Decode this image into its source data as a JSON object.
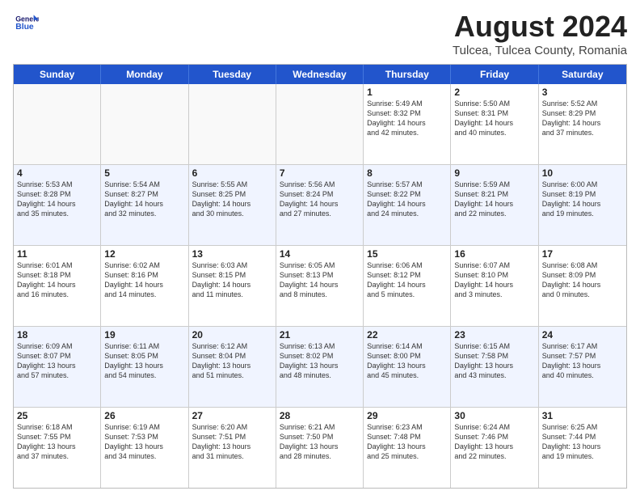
{
  "header": {
    "logo_line1": "General",
    "logo_line2": "Blue",
    "month": "August 2024",
    "location": "Tulcea, Tulcea County, Romania"
  },
  "weekdays": [
    "Sunday",
    "Monday",
    "Tuesday",
    "Wednesday",
    "Thursday",
    "Friday",
    "Saturday"
  ],
  "rows": [
    [
      {
        "day": "",
        "info": ""
      },
      {
        "day": "",
        "info": ""
      },
      {
        "day": "",
        "info": ""
      },
      {
        "day": "",
        "info": ""
      },
      {
        "day": "1",
        "info": "Sunrise: 5:49 AM\nSunset: 8:32 PM\nDaylight: 14 hours\nand 42 minutes."
      },
      {
        "day": "2",
        "info": "Sunrise: 5:50 AM\nSunset: 8:31 PM\nDaylight: 14 hours\nand 40 minutes."
      },
      {
        "day": "3",
        "info": "Sunrise: 5:52 AM\nSunset: 8:29 PM\nDaylight: 14 hours\nand 37 minutes."
      }
    ],
    [
      {
        "day": "4",
        "info": "Sunrise: 5:53 AM\nSunset: 8:28 PM\nDaylight: 14 hours\nand 35 minutes."
      },
      {
        "day": "5",
        "info": "Sunrise: 5:54 AM\nSunset: 8:27 PM\nDaylight: 14 hours\nand 32 minutes."
      },
      {
        "day": "6",
        "info": "Sunrise: 5:55 AM\nSunset: 8:25 PM\nDaylight: 14 hours\nand 30 minutes."
      },
      {
        "day": "7",
        "info": "Sunrise: 5:56 AM\nSunset: 8:24 PM\nDaylight: 14 hours\nand 27 minutes."
      },
      {
        "day": "8",
        "info": "Sunrise: 5:57 AM\nSunset: 8:22 PM\nDaylight: 14 hours\nand 24 minutes."
      },
      {
        "day": "9",
        "info": "Sunrise: 5:59 AM\nSunset: 8:21 PM\nDaylight: 14 hours\nand 22 minutes."
      },
      {
        "day": "10",
        "info": "Sunrise: 6:00 AM\nSunset: 8:19 PM\nDaylight: 14 hours\nand 19 minutes."
      }
    ],
    [
      {
        "day": "11",
        "info": "Sunrise: 6:01 AM\nSunset: 8:18 PM\nDaylight: 14 hours\nand 16 minutes."
      },
      {
        "day": "12",
        "info": "Sunrise: 6:02 AM\nSunset: 8:16 PM\nDaylight: 14 hours\nand 14 minutes."
      },
      {
        "day": "13",
        "info": "Sunrise: 6:03 AM\nSunset: 8:15 PM\nDaylight: 14 hours\nand 11 minutes."
      },
      {
        "day": "14",
        "info": "Sunrise: 6:05 AM\nSunset: 8:13 PM\nDaylight: 14 hours\nand 8 minutes."
      },
      {
        "day": "15",
        "info": "Sunrise: 6:06 AM\nSunset: 8:12 PM\nDaylight: 14 hours\nand 5 minutes."
      },
      {
        "day": "16",
        "info": "Sunrise: 6:07 AM\nSunset: 8:10 PM\nDaylight: 14 hours\nand 3 minutes."
      },
      {
        "day": "17",
        "info": "Sunrise: 6:08 AM\nSunset: 8:09 PM\nDaylight: 14 hours\nand 0 minutes."
      }
    ],
    [
      {
        "day": "18",
        "info": "Sunrise: 6:09 AM\nSunset: 8:07 PM\nDaylight: 13 hours\nand 57 minutes."
      },
      {
        "day": "19",
        "info": "Sunrise: 6:11 AM\nSunset: 8:05 PM\nDaylight: 13 hours\nand 54 minutes."
      },
      {
        "day": "20",
        "info": "Sunrise: 6:12 AM\nSunset: 8:04 PM\nDaylight: 13 hours\nand 51 minutes."
      },
      {
        "day": "21",
        "info": "Sunrise: 6:13 AM\nSunset: 8:02 PM\nDaylight: 13 hours\nand 48 minutes."
      },
      {
        "day": "22",
        "info": "Sunrise: 6:14 AM\nSunset: 8:00 PM\nDaylight: 13 hours\nand 45 minutes."
      },
      {
        "day": "23",
        "info": "Sunrise: 6:15 AM\nSunset: 7:58 PM\nDaylight: 13 hours\nand 43 minutes."
      },
      {
        "day": "24",
        "info": "Sunrise: 6:17 AM\nSunset: 7:57 PM\nDaylight: 13 hours\nand 40 minutes."
      }
    ],
    [
      {
        "day": "25",
        "info": "Sunrise: 6:18 AM\nSunset: 7:55 PM\nDaylight: 13 hours\nand 37 minutes."
      },
      {
        "day": "26",
        "info": "Sunrise: 6:19 AM\nSunset: 7:53 PM\nDaylight: 13 hours\nand 34 minutes."
      },
      {
        "day": "27",
        "info": "Sunrise: 6:20 AM\nSunset: 7:51 PM\nDaylight: 13 hours\nand 31 minutes."
      },
      {
        "day": "28",
        "info": "Sunrise: 6:21 AM\nSunset: 7:50 PM\nDaylight: 13 hours\nand 28 minutes."
      },
      {
        "day": "29",
        "info": "Sunrise: 6:23 AM\nSunset: 7:48 PM\nDaylight: 13 hours\nand 25 minutes."
      },
      {
        "day": "30",
        "info": "Sunrise: 6:24 AM\nSunset: 7:46 PM\nDaylight: 13 hours\nand 22 minutes."
      },
      {
        "day": "31",
        "info": "Sunrise: 6:25 AM\nSunset: 7:44 PM\nDaylight: 13 hours\nand 19 minutes."
      }
    ]
  ]
}
